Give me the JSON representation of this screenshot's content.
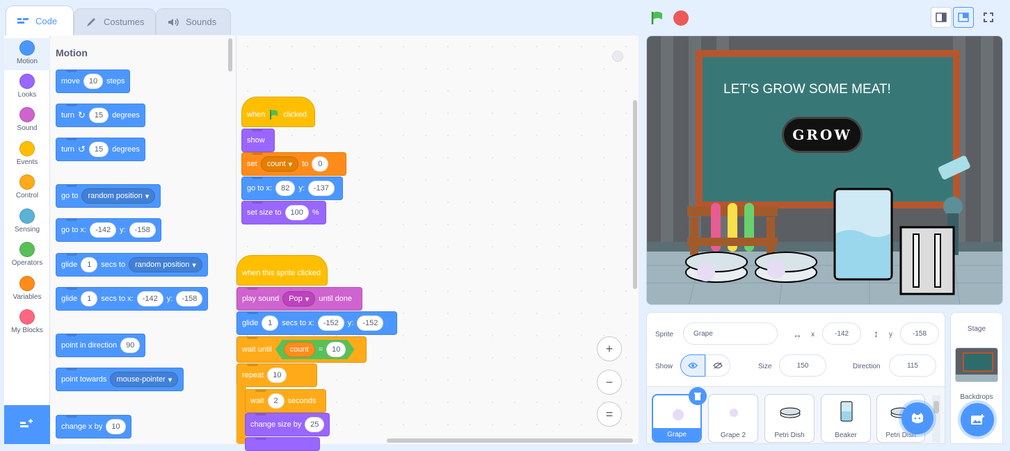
{
  "tabs": {
    "code": "Code",
    "costumes": "Costumes",
    "sounds": "Sounds"
  },
  "categories": [
    {
      "label": "Motion",
      "color": "#4c97ff"
    },
    {
      "label": "Looks",
      "color": "#9966ff"
    },
    {
      "label": "Sound",
      "color": "#cf63cf"
    },
    {
      "label": "Events",
      "color": "#ffbf00"
    },
    {
      "label": "Control",
      "color": "#ffab19"
    },
    {
      "label": "Sensing",
      "color": "#5cb1d6"
    },
    {
      "label": "Operators",
      "color": "#59c059"
    },
    {
      "label": "Variables",
      "color": "#ff8c1a"
    },
    {
      "label": "My Blocks",
      "color": "#ff6680"
    }
  ],
  "palette": {
    "heading": "Motion",
    "move": {
      "a": "move",
      "n": "10",
      "b": "steps"
    },
    "turn_cw": {
      "a": "turn",
      "n": "15",
      "b": "degrees"
    },
    "turn_ccw": {
      "a": "turn",
      "n": "15",
      "b": "degrees"
    },
    "goto": {
      "a": "go to",
      "d": "random position"
    },
    "gotoxy": {
      "a": "go to x:",
      "x": "-142",
      "b": "y:",
      "y": "-158"
    },
    "glide": {
      "a": "glide",
      "n": "1",
      "b": "secs to",
      "d": "random position"
    },
    "glidexy": {
      "a": "glide",
      "n": "1",
      "b": "secs to x:",
      "x": "-142",
      "c": "y:",
      "y": "-158"
    },
    "point": {
      "a": "point in direction",
      "n": "90"
    },
    "towards": {
      "a": "point towards",
      "d": "mouse-pointer"
    },
    "changex": {
      "a": "change x by",
      "n": "10"
    }
  },
  "script1": {
    "hat": {
      "a": "when",
      "b": "clicked"
    },
    "show": "show",
    "set": {
      "a": "set",
      "d": "count",
      "b": "to",
      "n": "0"
    },
    "goto": {
      "a": "go to x:",
      "x": "82",
      "b": "y:",
      "y": "-137"
    },
    "size": {
      "a": "set size to",
      "n": "100",
      "b": "%"
    }
  },
  "script2": {
    "hat": "when this sprite clicked",
    "play": {
      "a": "play sound",
      "d": "Pop",
      "b": "until done"
    },
    "glide": {
      "a": "glide",
      "n": "1",
      "b": "secs to x:",
      "x": "-152",
      "c": "y:",
      "y": "-152"
    },
    "wait_until": {
      "a": "wait until",
      "v": "count",
      "op": "=",
      "n": "10"
    },
    "repeat": {
      "a": "repeat",
      "n": "10"
    },
    "wait": {
      "a": "wait",
      "n": "2",
      "b": "seconds"
    },
    "change": {
      "a": "change size by",
      "n": "25"
    }
  },
  "zoom": {
    "in": "+",
    "out": "−",
    "reset": "="
  },
  "stage": {
    "headline": "LET'S GROW SOME MEAT!",
    "button": "GROW"
  },
  "sprite_info": {
    "sprite_label": "Sprite",
    "name": "Grape",
    "x_label": "x",
    "x": "-142",
    "y_label": "y",
    "y": "-158",
    "show_label": "Show",
    "size_label": "Size",
    "size": "150",
    "direction_label": "Direction",
    "direction": "115"
  },
  "sprites": [
    "Grape",
    "Grape 2",
    "Petri Dish",
    "Beaker",
    "Petri Dish"
  ],
  "stage_panel": {
    "title": "Stage",
    "backdrops": "Backdrops"
  },
  "colors": {
    "accent": "#4c97ff",
    "background": "#e5f0ff"
  }
}
